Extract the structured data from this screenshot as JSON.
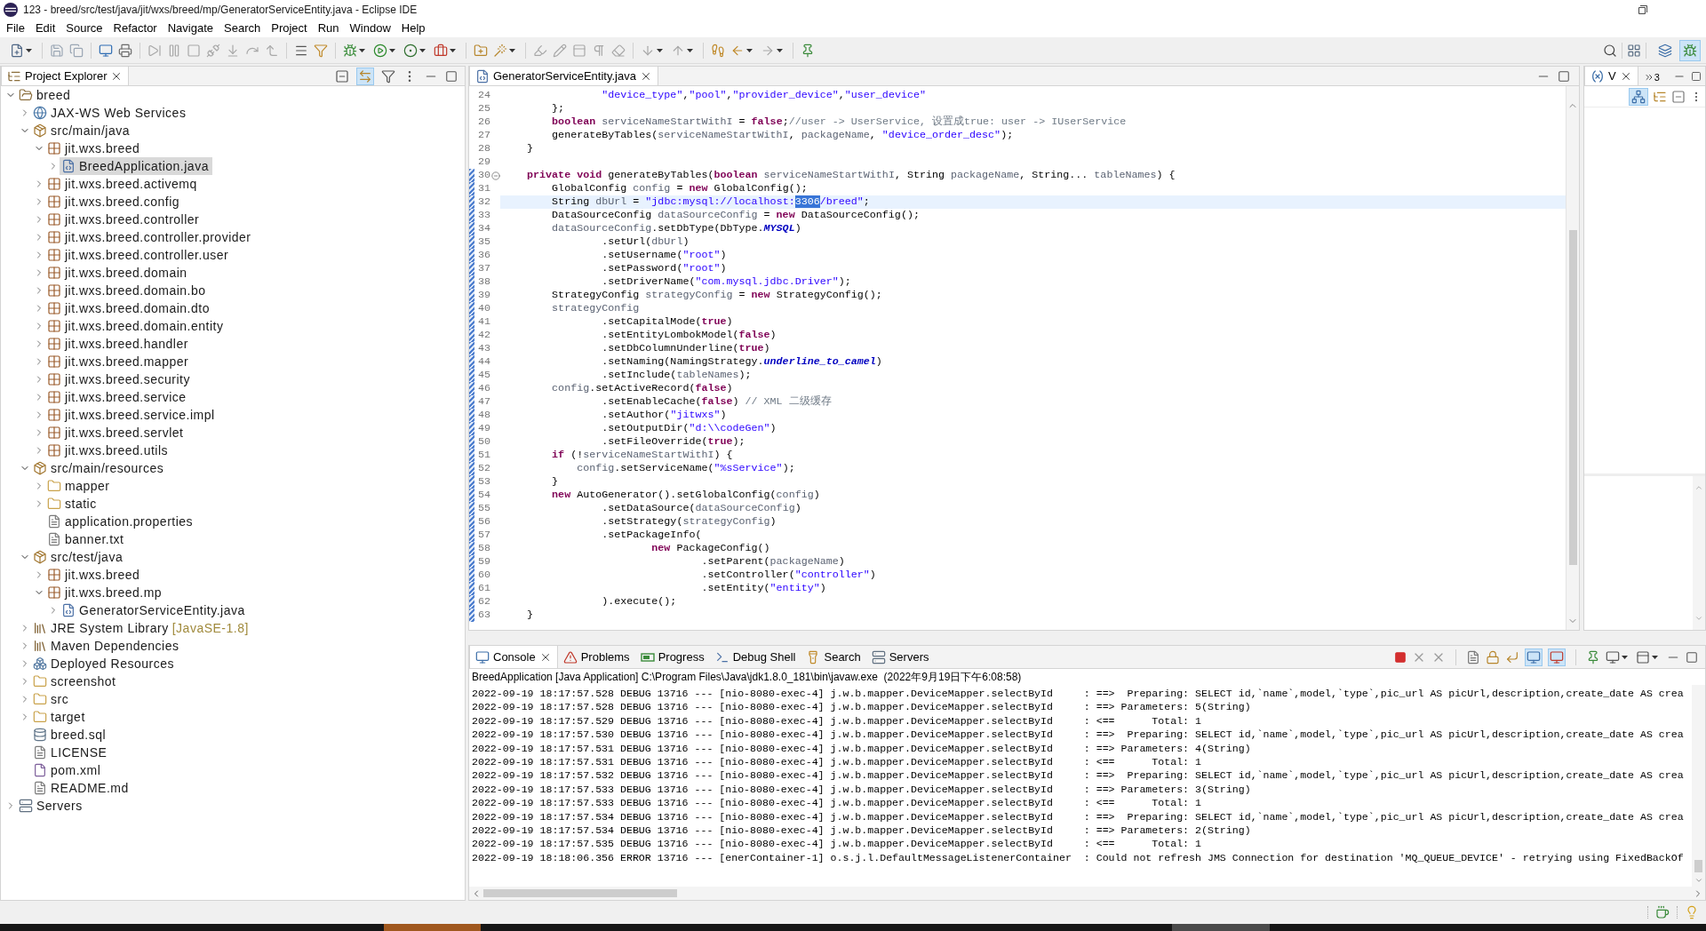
{
  "window": {
    "title": "123 - breed/src/test/java/jit/wxs/breed/mp/GeneratorServiceEntity.java - Eclipse IDE"
  },
  "menu": [
    "File",
    "Edit",
    "Source",
    "Refactor",
    "Navigate",
    "Search",
    "Project",
    "Run",
    "Window",
    "Help"
  ],
  "toolbar": {
    "perspectives": [
      {
        "kind": "javaee",
        "selected": false
      },
      {
        "kind": "debug",
        "selected": true
      }
    ]
  },
  "project_explorer": {
    "tabs": [
      {
        "label": "Project Explorer",
        "selected": true
      }
    ],
    "link_with_editor": true,
    "tree": [
      {
        "label": "breed",
        "kind": "project",
        "expanded": true,
        "selected": false,
        "children": [
          {
            "label": "JAX-WS Web Services",
            "kind": "webservices",
            "expanded": false,
            "selected": false
          },
          {
            "label": "src/main/java",
            "kind": "source-folder",
            "expanded": true,
            "selected": false,
            "children": [
              {
                "label": "jit.wxs.breed",
                "kind": "package",
                "expanded": true,
                "selected": false,
                "children": [
                  {
                    "label": "BreedApplication.java",
                    "kind": "java-file",
                    "expanded": false,
                    "selected": true
                  }
                ]
              },
              {
                "label": "jit.wxs.breed.activemq",
                "kind": "package",
                "expanded": false,
                "selected": false
              },
              {
                "label": "jit.wxs.breed.config",
                "kind": "package",
                "expanded": false,
                "selected": false
              },
              {
                "label": "jit.wxs.breed.controller",
                "kind": "package",
                "expanded": false,
                "selected": false
              },
              {
                "label": "jit.wxs.breed.controller.provider",
                "kind": "package",
                "expanded": false,
                "selected": false
              },
              {
                "label": "jit.wxs.breed.controller.user",
                "kind": "package",
                "expanded": false,
                "selected": false
              },
              {
                "label": "jit.wxs.breed.domain",
                "kind": "package",
                "expanded": false,
                "selected": false
              },
              {
                "label": "jit.wxs.breed.domain.bo",
                "kind": "package",
                "expanded": false,
                "selected": false
              },
              {
                "label": "jit.wxs.breed.domain.dto",
                "kind": "package",
                "expanded": false,
                "selected": false
              },
              {
                "label": "jit.wxs.breed.domain.entity",
                "kind": "package",
                "expanded": false,
                "selected": false
              },
              {
                "label": "jit.wxs.breed.handler",
                "kind": "package",
                "expanded": false,
                "selected": false
              },
              {
                "label": "jit.wxs.breed.mapper",
                "kind": "package",
                "expanded": false,
                "selected": false
              },
              {
                "label": "jit.wxs.breed.security",
                "kind": "package",
                "expanded": false,
                "selected": false
              },
              {
                "label": "jit.wxs.breed.service",
                "kind": "package",
                "expanded": false,
                "selected": false
              },
              {
                "label": "jit.wxs.breed.service.impl",
                "kind": "package",
                "expanded": false,
                "selected": false
              },
              {
                "label": "jit.wxs.breed.servlet",
                "kind": "package",
                "expanded": false,
                "selected": false
              },
              {
                "label": "jit.wxs.breed.utils",
                "kind": "package",
                "expanded": false,
                "selected": false
              }
            ]
          },
          {
            "label": "src/main/resources",
            "kind": "source-folder",
            "expanded": true,
            "selected": false,
            "children": [
              {
                "label": "mapper",
                "kind": "folder",
                "expanded": false,
                "selected": false
              },
              {
                "label": "static",
                "kind": "folder",
                "expanded": false,
                "selected": false
              },
              {
                "label": "application.properties",
                "kind": "text-file",
                "selected": false
              },
              {
                "label": "banner.txt",
                "kind": "text-file",
                "selected": false
              }
            ]
          },
          {
            "label": "src/test/java",
            "kind": "source-folder",
            "expanded": true,
            "selected": false,
            "children": [
              {
                "label": "jit.wxs.breed",
                "kind": "package",
                "expanded": false,
                "selected": false
              },
              {
                "label": "jit.wxs.breed.mp",
                "kind": "package",
                "expanded": true,
                "selected": false,
                "children": [
                  {
                    "label": "GeneratorServiceEntity.java",
                    "kind": "java-file",
                    "expanded": false,
                    "selected": false
                  }
                ]
              }
            ]
          },
          {
            "label": "JRE System Library",
            "decoration": "[JavaSE-1.8]",
            "kind": "library",
            "expanded": false,
            "selected": false
          },
          {
            "label": "Maven Dependencies",
            "kind": "library",
            "expanded": false,
            "selected": false
          },
          {
            "label": "Deployed Resources",
            "kind": "deployed",
            "expanded": false,
            "selected": false
          },
          {
            "label": "screenshot",
            "kind": "folder",
            "expanded": false,
            "selected": false
          },
          {
            "label": "src",
            "kind": "folder",
            "expanded": false,
            "selected": false
          },
          {
            "label": "target",
            "kind": "folder",
            "expanded": false,
            "selected": false
          },
          {
            "label": "breed.sql",
            "kind": "sql-file",
            "selected": false
          },
          {
            "label": "LICENSE",
            "kind": "text-file",
            "selected": false
          },
          {
            "label": "pom.xml",
            "kind": "xml-file",
            "selected": false
          },
          {
            "label": "README.md",
            "kind": "text-file",
            "selected": false
          }
        ]
      },
      {
        "label": "Servers",
        "kind": "servers",
        "expanded": false,
        "selected": false
      }
    ]
  },
  "editor": {
    "tabs": [
      {
        "label": "GeneratorServiceEntity.java",
        "selected": true
      }
    ],
    "lines": [
      {
        "number": "24",
        "changed": false,
        "current": false,
        "tokens": [
          {
            "kind": "string",
            "text": "                \"device_type\""
          },
          {
            "kind": "plain",
            "text": ","
          },
          {
            "kind": "string",
            "text": "\"pool\""
          },
          {
            "kind": "plain",
            "text": ","
          },
          {
            "kind": "string",
            "text": "\"provider_device\""
          },
          {
            "kind": "plain",
            "text": ","
          },
          {
            "kind": "string",
            "text": "\"user_device\""
          }
        ]
      },
      {
        "number": "25",
        "changed": false,
        "current": false,
        "tokens": [
          {
            "kind": "plain",
            "text": "        };"
          }
        ]
      },
      {
        "number": "26",
        "changed": false,
        "current": false,
        "tokens": [
          {
            "kind": "keyword",
            "text": "        boolean"
          },
          {
            "kind": "variable",
            "text": " serviceNameStartWithI"
          },
          {
            "kind": "plain",
            "text": " = "
          },
          {
            "kind": "keyword",
            "text": "false"
          },
          {
            "kind": "plain",
            "text": ";"
          },
          {
            "kind": "comment",
            "text": "//user -> UserService, 设置成true: user -> IUserService"
          }
        ]
      },
      {
        "number": "27",
        "changed": false,
        "current": false,
        "tokens": [
          {
            "kind": "plain",
            "text": "        generateByTables("
          },
          {
            "kind": "variable",
            "text": "serviceNameStartWithI"
          },
          {
            "kind": "plain",
            "text": ", "
          },
          {
            "kind": "variable",
            "text": "packageName"
          },
          {
            "kind": "plain",
            "text": ", "
          },
          {
            "kind": "string",
            "text": "\"device_order_desc\""
          },
          {
            "kind": "plain",
            "text": ");"
          }
        ]
      },
      {
        "number": "28",
        "changed": false,
        "current": false,
        "tokens": [
          {
            "kind": "plain",
            "text": "    }"
          }
        ]
      },
      {
        "number": "29",
        "changed": false,
        "current": false
      },
      {
        "number": "30",
        "changed": true,
        "current": false,
        "expanded": true,
        "tokens": [
          {
            "kind": "keyword",
            "text": "    private"
          },
          {
            "kind": "keyword",
            "text": " void"
          },
          {
            "kind": "plain",
            "text": " generateByTables("
          },
          {
            "kind": "keyword",
            "text": "boolean"
          },
          {
            "kind": "variable",
            "text": " serviceNameStartWithI"
          },
          {
            "kind": "plain",
            "text": ", String "
          },
          {
            "kind": "variable",
            "text": "packageName"
          },
          {
            "kind": "plain",
            "text": ", String... "
          },
          {
            "kind": "variable",
            "text": "tableNames"
          },
          {
            "kind": "plain",
            "text": ") {"
          }
        ]
      },
      {
        "number": "31",
        "changed": true,
        "current": false,
        "tokens": [
          {
            "kind": "plain",
            "text": "        GlobalConfig "
          },
          {
            "kind": "variable",
            "text": "config"
          },
          {
            "kind": "plain",
            "text": " = "
          },
          {
            "kind": "keyword",
            "text": "new"
          },
          {
            "kind": "plain",
            "text": " GlobalConfig();"
          }
        ]
      },
      {
        "number": "32",
        "changed": true,
        "current": true,
        "tokens": [
          {
            "kind": "plain",
            "text": "        String "
          },
          {
            "kind": "variable",
            "text": "dbUrl"
          },
          {
            "kind": "plain",
            "text": " = "
          },
          {
            "kind": "string",
            "text": "\"jdbc:mysql://localhost:"
          },
          {
            "kind": "selection",
            "text": "3306"
          },
          {
            "kind": "string",
            "text": "/breed\""
          },
          {
            "kind": "plain",
            "text": ";"
          }
        ]
      },
      {
        "number": "33",
        "changed": true,
        "current": false,
        "tokens": [
          {
            "kind": "plain",
            "text": "        DataSourceConfig "
          },
          {
            "kind": "variable",
            "text": "dataSourceConfig"
          },
          {
            "kind": "plain",
            "text": " = "
          },
          {
            "kind": "keyword",
            "text": "new"
          },
          {
            "kind": "plain",
            "text": " DataSourceConfig();"
          }
        ]
      },
      {
        "number": "34",
        "changed": true,
        "current": false,
        "tokens": [
          {
            "kind": "variable",
            "text": "        dataSourceConfig"
          },
          {
            "kind": "plain",
            "text": ".setDbType(DbType."
          },
          {
            "kind": "constant",
            "text": "MYSQL"
          },
          {
            "kind": "plain",
            "text": ")"
          }
        ]
      },
      {
        "number": "35",
        "changed": true,
        "current": false,
        "tokens": [
          {
            "kind": "plain",
            "text": "                .setUrl("
          },
          {
            "kind": "variable",
            "text": "dbUrl"
          },
          {
            "kind": "plain",
            "text": ")"
          }
        ]
      },
      {
        "number": "36",
        "changed": true,
        "current": false,
        "tokens": [
          {
            "kind": "plain",
            "text": "                .setUsername("
          },
          {
            "kind": "string",
            "text": "\"root\""
          },
          {
            "kind": "plain",
            "text": ")"
          }
        ]
      },
      {
        "number": "37",
        "changed": true,
        "current": false,
        "tokens": [
          {
            "kind": "plain",
            "text": "                .setPassword("
          },
          {
            "kind": "string",
            "text": "\"root\""
          },
          {
            "kind": "plain",
            "text": ")"
          }
        ]
      },
      {
        "number": "38",
        "changed": true,
        "current": false,
        "tokens": [
          {
            "kind": "plain",
            "text": "                .setDriverName("
          },
          {
            "kind": "string",
            "text": "\"com.mysql.jdbc.Driver\""
          },
          {
            "kind": "plain",
            "text": ");"
          }
        ]
      },
      {
        "number": "39",
        "changed": true,
        "current": false,
        "tokens": [
          {
            "kind": "plain",
            "text": "        StrategyConfig "
          },
          {
            "kind": "variable",
            "text": "strategyConfig"
          },
          {
            "kind": "plain",
            "text": " = "
          },
          {
            "kind": "keyword",
            "text": "new"
          },
          {
            "kind": "plain",
            "text": " StrategyConfig();"
          }
        ]
      },
      {
        "number": "40",
        "changed": true,
        "current": false,
        "tokens": [
          {
            "kind": "variable",
            "text": "        strategyConfig"
          }
        ]
      },
      {
        "number": "41",
        "changed": true,
        "current": false,
        "tokens": [
          {
            "kind": "plain",
            "text": "                .setCapitalMode("
          },
          {
            "kind": "keyword",
            "text": "true"
          },
          {
            "kind": "plain",
            "text": ")"
          }
        ]
      },
      {
        "number": "42",
        "changed": true,
        "current": false,
        "tokens": [
          {
            "kind": "plain",
            "text": "                .setEntityLombokModel("
          },
          {
            "kind": "keyword",
            "text": "false"
          },
          {
            "kind": "plain",
            "text": ")"
          }
        ]
      },
      {
        "number": "43",
        "changed": true,
        "current": false,
        "tokens": [
          {
            "kind": "plain",
            "text": "                .setDbColumnUnderline("
          },
          {
            "kind": "keyword",
            "text": "true"
          },
          {
            "kind": "plain",
            "text": ")"
          }
        ]
      },
      {
        "number": "44",
        "changed": true,
        "current": false,
        "tokens": [
          {
            "kind": "plain",
            "text": "                .setNaming(NamingStrategy."
          },
          {
            "kind": "constant",
            "text": "underline_to_camel"
          },
          {
            "kind": "plain",
            "text": ")"
          }
        ]
      },
      {
        "number": "45",
        "changed": true,
        "current": false,
        "tokens": [
          {
            "kind": "plain",
            "text": "                .setInclude("
          },
          {
            "kind": "variable",
            "text": "tableNames"
          },
          {
            "kind": "plain",
            "text": ");"
          }
        ]
      },
      {
        "number": "46",
        "changed": true,
        "current": false,
        "tokens": [
          {
            "kind": "variable",
            "text": "        config"
          },
          {
            "kind": "plain",
            "text": ".setActiveRecord("
          },
          {
            "kind": "keyword",
            "text": "false"
          },
          {
            "kind": "plain",
            "text": ")"
          }
        ]
      },
      {
        "number": "47",
        "changed": true,
        "current": false,
        "tokens": [
          {
            "kind": "plain",
            "text": "                .setEnableCache("
          },
          {
            "kind": "keyword",
            "text": "false"
          },
          {
            "kind": "plain",
            "text": ") "
          },
          {
            "kind": "comment",
            "text": "// XML 二级缓存"
          }
        ]
      },
      {
        "number": "48",
        "changed": true,
        "current": false,
        "tokens": [
          {
            "kind": "plain",
            "text": "                .setAuthor("
          },
          {
            "kind": "string",
            "text": "\"jitwxs\""
          },
          {
            "kind": "plain",
            "text": ")"
          }
        ]
      },
      {
        "number": "49",
        "changed": true,
        "current": false,
        "tokens": [
          {
            "kind": "plain",
            "text": "                .setOutputDir("
          },
          {
            "kind": "string",
            "text": "\"d:\\\\codeGen\""
          },
          {
            "kind": "plain",
            "text": ")"
          }
        ]
      },
      {
        "number": "50",
        "changed": true,
        "current": false,
        "tokens": [
          {
            "kind": "plain",
            "text": "                .setFileOverride("
          },
          {
            "kind": "keyword",
            "text": "true"
          },
          {
            "kind": "plain",
            "text": ");"
          }
        ]
      },
      {
        "number": "51",
        "changed": true,
        "current": false,
        "tokens": [
          {
            "kind": "keyword",
            "text": "        if"
          },
          {
            "kind": "plain",
            "text": " (!"
          },
          {
            "kind": "variable",
            "text": "serviceNameStartWithI"
          },
          {
            "kind": "plain",
            "text": ") {"
          }
        ]
      },
      {
        "number": "52",
        "changed": true,
        "current": false,
        "tokens": [
          {
            "kind": "variable",
            "text": "            config"
          },
          {
            "kind": "plain",
            "text": ".setServiceName("
          },
          {
            "kind": "string",
            "text": "\"%sService\""
          },
          {
            "kind": "plain",
            "text": ");"
          }
        ]
      },
      {
        "number": "53",
        "changed": true,
        "current": false,
        "tokens": [
          {
            "kind": "plain",
            "text": "        }"
          }
        ]
      },
      {
        "number": "54",
        "changed": true,
        "current": false,
        "tokens": [
          {
            "kind": "keyword",
            "text": "        new"
          },
          {
            "kind": "plain",
            "text": " AutoGenerator().setGlobalConfig("
          },
          {
            "kind": "variable",
            "text": "config"
          },
          {
            "kind": "plain",
            "text": ")"
          }
        ]
      },
      {
        "number": "55",
        "changed": true,
        "current": false,
        "tokens": [
          {
            "kind": "plain",
            "text": "                .setDataSource("
          },
          {
            "kind": "variable",
            "text": "dataSourceConfig"
          },
          {
            "kind": "plain",
            "text": ")"
          }
        ]
      },
      {
        "number": "56",
        "changed": true,
        "current": false,
        "tokens": [
          {
            "kind": "plain",
            "text": "                .setStrategy("
          },
          {
            "kind": "variable",
            "text": "strategyConfig"
          },
          {
            "kind": "plain",
            "text": ")"
          }
        ]
      },
      {
        "number": "57",
        "changed": true,
        "current": false,
        "tokens": [
          {
            "kind": "plain",
            "text": "                .setPackageInfo("
          }
        ]
      },
      {
        "number": "58",
        "changed": true,
        "current": false,
        "tokens": [
          {
            "kind": "keyword",
            "text": "                        new"
          },
          {
            "kind": "plain",
            "text": " PackageConfig()"
          }
        ]
      },
      {
        "number": "59",
        "changed": true,
        "current": false,
        "tokens": [
          {
            "kind": "plain",
            "text": "                                .setParent("
          },
          {
            "kind": "variable",
            "text": "packageName"
          },
          {
            "kind": "plain",
            "text": ")"
          }
        ]
      },
      {
        "number": "60",
        "changed": true,
        "current": false,
        "tokens": [
          {
            "kind": "plain",
            "text": "                                .setController("
          },
          {
            "kind": "string",
            "text": "\"controller\""
          },
          {
            "kind": "plain",
            "text": ")"
          }
        ]
      },
      {
        "number": "61",
        "changed": true,
        "current": false,
        "tokens": [
          {
            "kind": "plain",
            "text": "                                .setEntity("
          },
          {
            "kind": "string",
            "text": "\"entity\""
          },
          {
            "kind": "plain",
            "text": ")"
          }
        ]
      },
      {
        "number": "62",
        "changed": true,
        "current": false,
        "tokens": [
          {
            "kind": "plain",
            "text": "                ).execute();"
          }
        ]
      },
      {
        "number": "63",
        "changed": true,
        "current": false,
        "tokens": [
          {
            "kind": "plain",
            "text": "    }"
          }
        ]
      }
    ]
  },
  "side_panel": {
    "tabs": [
      {
        "label": "V",
        "selected": true
      }
    ],
    "hidden_count": "3",
    "show_type_names": true
  },
  "console": {
    "tabs": [
      {
        "label": "Console",
        "kind": "console",
        "selected": true
      },
      {
        "label": "Problems",
        "kind": "problems",
        "selected": false
      },
      {
        "label": "Progress",
        "kind": "progress",
        "selected": false
      },
      {
        "label": "Debug Shell",
        "kind": "debug-shell",
        "selected": false
      },
      {
        "label": "Search",
        "kind": "search",
        "selected": false
      },
      {
        "label": "Servers",
        "kind": "servers",
        "selected": false
      }
    ],
    "show_on_stdout": true,
    "show_on_stderr": true,
    "launch": "BreedApplication [Java Application] C:\\Program Files\\Java\\jdk1.8.0_181\\bin\\javaw.exe  (2022年9月19日下午6:08:58)",
    "lines": [
      "2022-09-19 18:17:57.528 DEBUG 13716 --- [nio-8080-exec-4] j.w.b.mapper.DeviceMapper.selectById     : ==>  Preparing: SELECT id,`name`,model,`type`,pic_url AS picUrl,description,create_date AS crea",
      "2022-09-19 18:17:57.528 DEBUG 13716 --- [nio-8080-exec-4] j.w.b.mapper.DeviceMapper.selectById     : ==> Parameters: 5(String)",
      "2022-09-19 18:17:57.529 DEBUG 13716 --- [nio-8080-exec-4] j.w.b.mapper.DeviceMapper.selectById     : <==      Total: 1",
      "2022-09-19 18:17:57.530 DEBUG 13716 --- [nio-8080-exec-4] j.w.b.mapper.DeviceMapper.selectById     : ==>  Preparing: SELECT id,`name`,model,`type`,pic_url AS picUrl,description,create_date AS crea",
      "2022-09-19 18:17:57.531 DEBUG 13716 --- [nio-8080-exec-4] j.w.b.mapper.DeviceMapper.selectById     : ==> Parameters: 4(String)",
      "2022-09-19 18:17:57.531 DEBUG 13716 --- [nio-8080-exec-4] j.w.b.mapper.DeviceMapper.selectById     : <==      Total: 1",
      "2022-09-19 18:17:57.532 DEBUG 13716 --- [nio-8080-exec-4] j.w.b.mapper.DeviceMapper.selectById     : ==>  Preparing: SELECT id,`name`,model,`type`,pic_url AS picUrl,description,create_date AS crea",
      "2022-09-19 18:17:57.533 DEBUG 13716 --- [nio-8080-exec-4] j.w.b.mapper.DeviceMapper.selectById     : ==> Parameters: 3(String)",
      "2022-09-19 18:17:57.533 DEBUG 13716 --- [nio-8080-exec-4] j.w.b.mapper.DeviceMapper.selectById     : <==      Total: 1",
      "2022-09-19 18:17:57.534 DEBUG 13716 --- [nio-8080-exec-4] j.w.b.mapper.DeviceMapper.selectById     : ==>  Preparing: SELECT id,`name`,model,`type`,pic_url AS picUrl,description,create_date AS crea",
      "2022-09-19 18:17:57.534 DEBUG 13716 --- [nio-8080-exec-4] j.w.b.mapper.DeviceMapper.selectById     : ==> Parameters: 2(String)",
      "2022-09-19 18:17:57.535 DEBUG 13716 --- [nio-8080-exec-4] j.w.b.mapper.DeviceMapper.selectById     : <==      Total: 1",
      "2022-09-19 18:18:06.356 ERROR 13716 --- [enerContainer-1] o.s.j.l.DefaultMessageListenerContainer  : Could not refresh JMS Connection for destination 'MQ_QUEUE_DEVICE' - retrying using FixedBackOf"
    ]
  }
}
